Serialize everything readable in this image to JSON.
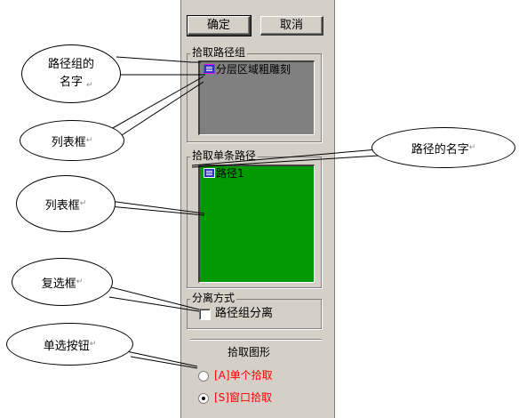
{
  "buttons": {
    "ok": "确定",
    "cancel": "取消"
  },
  "group_path_group": {
    "legend": "拾取路径组",
    "items": [
      "分层区域粗雕刻"
    ],
    "bg_color": "#808080"
  },
  "group_single_path": {
    "legend": "拾取单条路径",
    "items": [
      "路径1"
    ],
    "bg_color": "#009900"
  },
  "group_separate": {
    "legend": "分离方式",
    "checkbox_label": "路径组分离",
    "checked": false
  },
  "pick_shape": {
    "title": "拾取图形",
    "options": [
      {
        "label": "[A]单个拾取",
        "selected": false
      },
      {
        "label": "[S]窗口拾取",
        "selected": true
      }
    ],
    "option_color": "#ff0000"
  },
  "callouts": {
    "path_group_name": "路径组的\n名字",
    "list_box_1": "列表框",
    "path_name": "路径的名字",
    "list_box_2": "列表框",
    "checkbox": "复选框",
    "radio_button": "单选按钮",
    "mark": "↵"
  }
}
